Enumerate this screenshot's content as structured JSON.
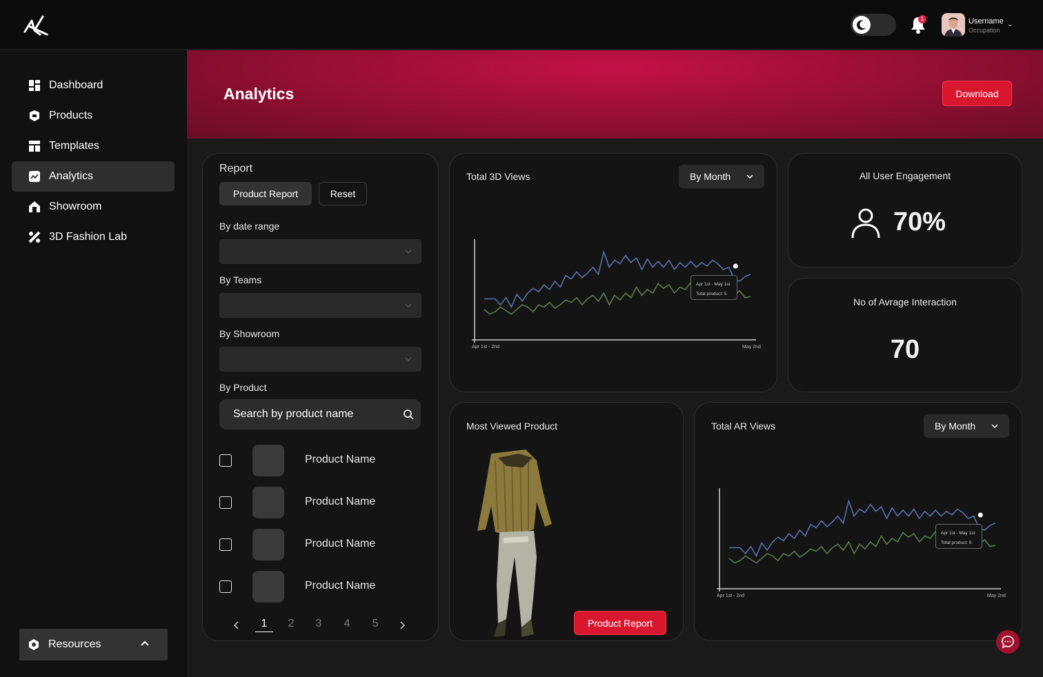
{
  "header": {
    "logo": "brand-logo",
    "notification_count": "1",
    "user": {
      "name": "Username",
      "occupation": "Occupation"
    }
  },
  "sidebar": {
    "items": [
      {
        "label": "Dashboard",
        "icon": "dashboard-icon"
      },
      {
        "label": "Products",
        "icon": "products-icon"
      },
      {
        "label": "Templates",
        "icon": "templates-icon"
      },
      {
        "label": "Analytics",
        "icon": "analytics-icon",
        "active": true
      },
      {
        "label": "Showroom",
        "icon": "showroom-icon"
      },
      {
        "label": "3D Fashion Lab",
        "icon": "fashion-lab-icon"
      }
    ],
    "resources_label": "Resources"
  },
  "banner": {
    "title": "Analytics",
    "download_label": "Download"
  },
  "report": {
    "title": "Report",
    "product_report_label": "Product Report",
    "reset_label": "Reset",
    "date_range_label": "By date range",
    "teams_label": "By Teams",
    "showroom_label": "By Showroom",
    "product_label": "By Product",
    "search_placeholder": "Search by product name",
    "products": [
      "Product Name",
      "Product Name",
      "Product Name",
      "Product Name"
    ],
    "pages": [
      "1",
      "2",
      "3",
      "4",
      "5"
    ],
    "current_page": "1"
  },
  "views3d": {
    "title": "Total 3D Views",
    "period": "By Month",
    "x_start": "Apr 1st - 2nd",
    "x_end": "May 2nd",
    "tooltip_range": "Apr 1st - May 1st",
    "tooltip_value": "Total product: 5"
  },
  "engagement": {
    "title": "All User Engagement",
    "value": "70%"
  },
  "interaction": {
    "title": "No of Avrage Interaction",
    "value": "70"
  },
  "most_viewed": {
    "title": "Most Viewed Product",
    "button_label": "Product Report"
  },
  "ar_views": {
    "title": "Total AR Views",
    "period": "By Month",
    "x_start": "Apr 1st - 2nd",
    "x_end": "May 2nd",
    "tooltip_range": "Apr 1st - May 1st",
    "tooltip_value": "Total product: 5"
  },
  "colors": {
    "accent": "#d8172f",
    "series_blue": "#5b6fb0",
    "series_green": "#5e7a4e"
  },
  "chart_data": [
    {
      "type": "line",
      "x": [
        1,
        2,
        3,
        4,
        5,
        6,
        7,
        8,
        9,
        10,
        11,
        12,
        13,
        14,
        15,
        16,
        17,
        18,
        19,
        20,
        21,
        22,
        23,
        24,
        25,
        26,
        27,
        28,
        29,
        30,
        31,
        32,
        33,
        34,
        35,
        36,
        37,
        38,
        39,
        40,
        41,
        42,
        43,
        44,
        45,
        46,
        47,
        48,
        49,
        50
      ],
      "series": [
        {
          "values": [
            35,
            35,
            35,
            30,
            36,
            28,
            39,
            33,
            40,
            44,
            41,
            47,
            43,
            50,
            45,
            55,
            52,
            58,
            53,
            57,
            62,
            56,
            75,
            62,
            68,
            65,
            72,
            66,
            70,
            60,
            69,
            62,
            67,
            62,
            68,
            60,
            66,
            62,
            67,
            62,
            66,
            63,
            68,
            65,
            60,
            62,
            52,
            50,
            54,
            56
          ]
        },
        {
          "values": [
            26,
            22,
            24,
            28,
            25,
            22,
            26,
            30,
            28,
            24,
            30,
            28,
            32,
            27,
            30,
            34,
            32,
            36,
            30,
            35,
            38,
            33,
            40,
            30,
            38,
            34,
            40,
            36,
            45,
            38,
            43,
            40,
            48,
            44,
            47,
            40,
            45,
            43,
            49,
            42,
            46,
            38,
            44,
            41,
            43,
            40,
            37,
            42,
            36,
            37
          ]
        }
      ],
      "xlim": [
        1,
        50
      ],
      "ylim": [
        0,
        100
      ]
    },
    {
      "type": "line",
      "x": [
        1,
        2,
        3,
        4,
        5,
        6,
        7,
        8,
        9,
        10,
        11,
        12,
        13,
        14,
        15,
        16,
        17,
        18,
        19,
        20,
        21,
        22,
        23,
        24,
        25,
        26,
        27,
        28,
        29,
        30,
        31,
        32,
        33,
        34,
        35,
        36,
        37,
        38,
        39,
        40,
        41,
        42,
        43,
        44,
        45,
        46,
        47,
        48,
        49,
        50
      ],
      "series": [
        {
          "values": [
            35,
            35,
            35,
            30,
            36,
            28,
            39,
            33,
            40,
            44,
            41,
            47,
            43,
            50,
            45,
            55,
            52,
            58,
            53,
            57,
            62,
            56,
            75,
            62,
            68,
            65,
            72,
            66,
            70,
            60,
            69,
            62,
            67,
            62,
            68,
            60,
            66,
            62,
            67,
            62,
            66,
            63,
            68,
            65,
            60,
            62,
            52,
            50,
            54,
            56
          ]
        },
        {
          "values": [
            26,
            22,
            24,
            28,
            25,
            22,
            26,
            30,
            28,
            24,
            30,
            28,
            32,
            27,
            30,
            34,
            32,
            36,
            30,
            35,
            38,
            33,
            40,
            30,
            38,
            34,
            40,
            36,
            45,
            38,
            43,
            40,
            48,
            44,
            47,
            40,
            45,
            43,
            49,
            42,
            46,
            38,
            44,
            41,
            43,
            40,
            37,
            42,
            36,
            37
          ]
        }
      ],
      "xlim": [
        1,
        50
      ],
      "ylim": [
        0,
        100
      ]
    }
  ]
}
